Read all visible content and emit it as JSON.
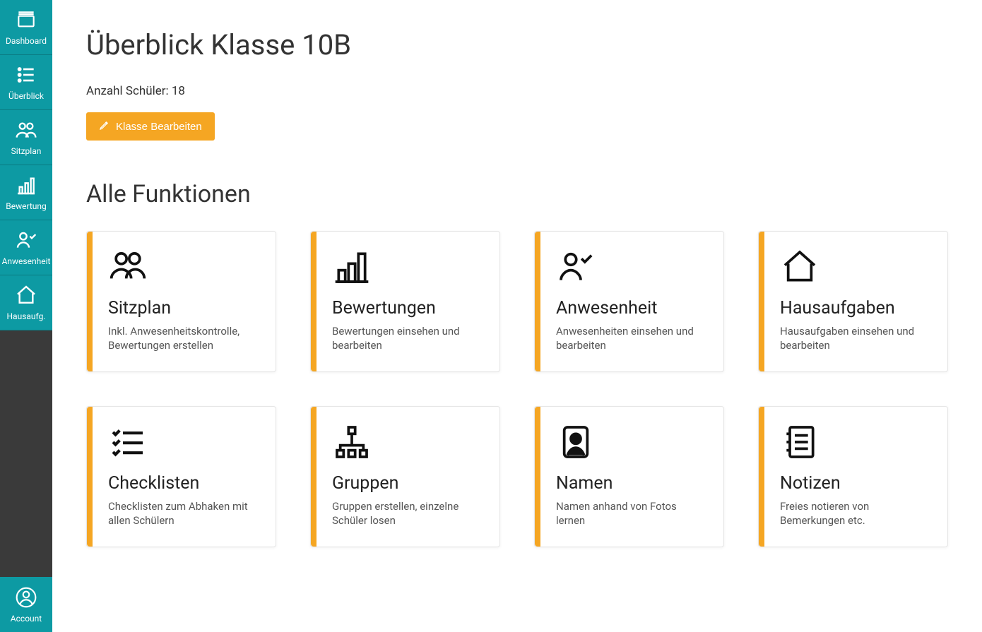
{
  "sidebar": {
    "items": [
      {
        "label": "Dashboard"
      },
      {
        "label": "Überblick"
      },
      {
        "label": "Sitzplan"
      },
      {
        "label": "Bewertung"
      },
      {
        "label": "Anwesenheit"
      },
      {
        "label": "Hausaufg."
      }
    ],
    "account_label": "Account"
  },
  "header": {
    "title": "Überblick Klasse 10B",
    "student_count": "Anzahl Schüler: 18",
    "edit_button": "Klasse Bearbeiten"
  },
  "section_title": "Alle Funktionen",
  "cards": [
    {
      "title": "Sitzplan",
      "desc": "Inkl. Anwesenheitskontrolle, Bewertungen erstellen"
    },
    {
      "title": "Bewertungen",
      "desc": "Bewertungen einsehen und bearbeiten"
    },
    {
      "title": "Anwesenheit",
      "desc": "Anwesenheiten einsehen und bearbeiten"
    },
    {
      "title": "Hausaufgaben",
      "desc": "Hausaufgaben einsehen und bearbeiten"
    },
    {
      "title": "Checklisten",
      "desc": "Checklisten zum Abhaken mit allen Schülern"
    },
    {
      "title": "Gruppen",
      "desc": "Gruppen erstellen, einzelne Schüler losen"
    },
    {
      "title": "Namen",
      "desc": "Namen anhand von Fotos lernen"
    },
    {
      "title": "Notizen",
      "desc": "Freies notieren von Bemerkungen etc."
    }
  ]
}
